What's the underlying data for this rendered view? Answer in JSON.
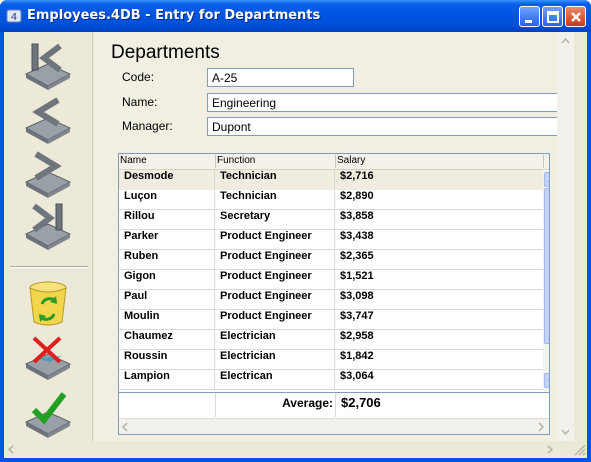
{
  "window": {
    "title": "Employees.4DB - Entry for Departments"
  },
  "form": {
    "heading": "Departments",
    "fields": [
      {
        "label": "Code:",
        "value": "A-25"
      },
      {
        "label": "Name:",
        "value": "Engineering"
      },
      {
        "label": "Manager:",
        "value": "Dupont"
      }
    ]
  },
  "toolbar": {
    "buttons": [
      "first-record-icon",
      "previous-record-icon",
      "next-record-icon",
      "last-record-icon",
      "delete-record-icon",
      "cancel-icon",
      "accept-icon"
    ]
  },
  "employees": {
    "headers": [
      "Name",
      "Function",
      "Salary"
    ],
    "rows": [
      {
        "name": "Desmode",
        "function": "Technician",
        "salary": "$2,716"
      },
      {
        "name": "Luçon",
        "function": "Technician",
        "salary": "$2,890"
      },
      {
        "name": "Rillou",
        "function": "Secretary",
        "salary": "$3,858"
      },
      {
        "name": "Parker",
        "function": "Product Engineer",
        "salary": "$3,438"
      },
      {
        "name": "Ruben",
        "function": "Product Engineer",
        "salary": "$2,365"
      },
      {
        "name": "Gigon",
        "function": "Product Engineer",
        "salary": "$1,521"
      },
      {
        "name": "Paul",
        "function": "Product Engineer",
        "salary": "$3,098"
      },
      {
        "name": "Moulin",
        "function": "Product Engineer",
        "salary": "$3,747"
      },
      {
        "name": "Chaumez",
        "function": "Electrician",
        "salary": "$2,958"
      },
      {
        "name": "Roussin",
        "function": "Electrician",
        "salary": "$1,842"
      },
      {
        "name": "Lampion",
        "function": "Electrican",
        "salary": "$3,064"
      }
    ],
    "average_label": "Average:",
    "average_value": "$2,706"
  },
  "colors": {
    "titlebar": "#0054e3",
    "form_bg": "#f1efe2",
    "field_border": "#7f9db9"
  }
}
